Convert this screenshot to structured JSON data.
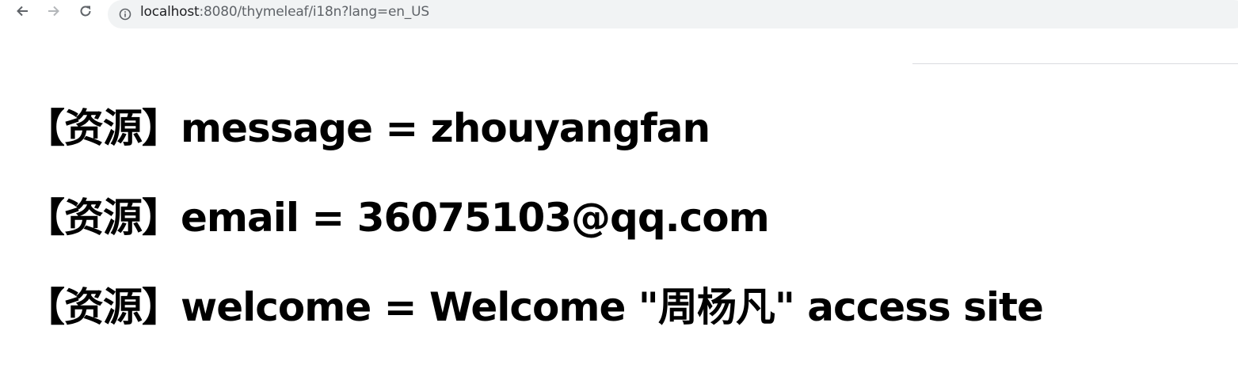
{
  "browser": {
    "url_host": "localhost",
    "url_rest": ":8080/thymeleaf/i18n?lang=en_US"
  },
  "resources": [
    {
      "text": "【资源】message = zhouyangfan"
    },
    {
      "text": "【资源】email = 36075103@qq.com"
    },
    {
      "text": "【资源】welcome = Welcome \"周杨凡\" access site"
    }
  ],
  "icons": {
    "back": "arrow-left-icon",
    "forward": "arrow-right-icon",
    "reload": "reload-icon",
    "info": "info-circle-icon"
  },
  "colors": {
    "omnibox_bg": "#f1f3f4",
    "text": "#000000",
    "url_secondary": "#5f6368"
  }
}
